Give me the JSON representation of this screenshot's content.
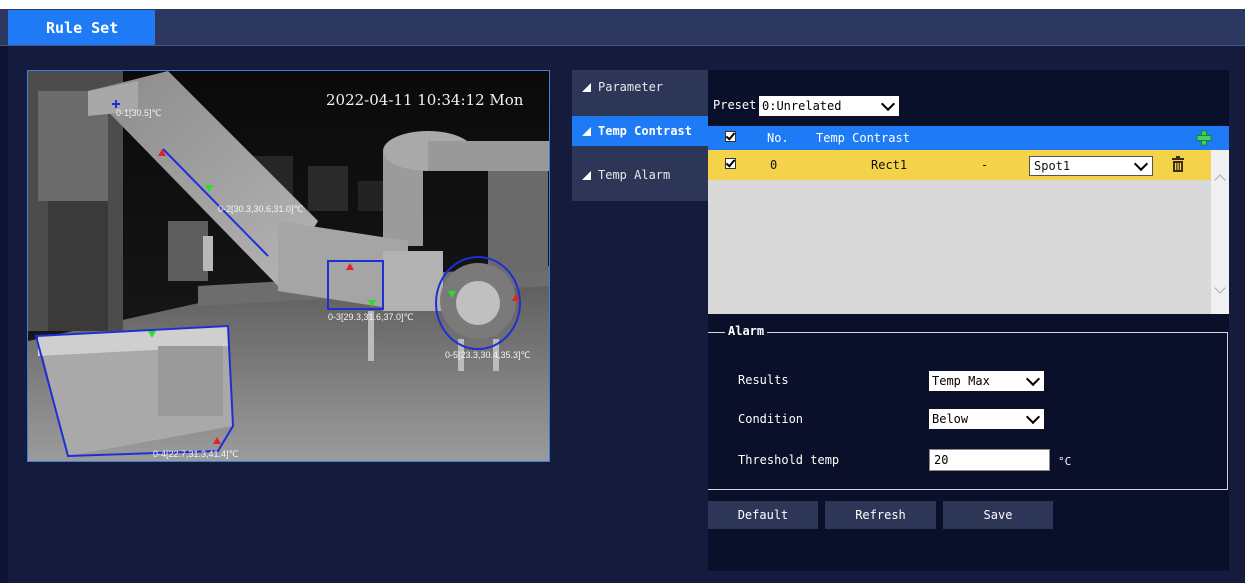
{
  "header": {
    "tab_label": "Rule Set"
  },
  "thermal": {
    "timestamp": "2022-04-11 10:34:12 Mon",
    "markers": [
      {
        "name": "marker-0-1",
        "text": "0-1[30.5]℃"
      },
      {
        "name": "marker-0-2",
        "text": "0-2[30.3,30.6,31.0]℃"
      },
      {
        "name": "marker-0-3",
        "text": "0-3[29.3,31.6,37.0]℃"
      },
      {
        "name": "marker-0-4",
        "text": "0-4[22.7,31.3,41.4]℃"
      },
      {
        "name": "marker-0-5",
        "text": "0-5[23.3,30.4,35.3]℃"
      }
    ]
  },
  "sidenav": {
    "items": [
      {
        "label": "Parameter",
        "active": false
      },
      {
        "label": "Temp Contrast",
        "active": true
      },
      {
        "label": "Temp Alarm",
        "active": false
      }
    ]
  },
  "panel": {
    "preset_label": "Preset",
    "preset_value": "0:Unrelated",
    "table": {
      "headers": {
        "no": "No.",
        "name": "Temp Contrast"
      },
      "rows": [
        {
          "checked": true,
          "no": "0",
          "rule_a": "Rect1",
          "relation": "-",
          "rule_b": "Spot1"
        }
      ]
    },
    "alarm": {
      "title": "Alarm",
      "results_label": "Results",
      "results_value": "Temp Max",
      "condition_label": "Condition",
      "condition_value": "Below",
      "threshold_label": "Threshold temp",
      "threshold_value": "20",
      "threshold_unit": "°C"
    },
    "buttons": {
      "default": "Default",
      "refresh": "Refresh",
      "save": "Save"
    }
  },
  "colors": {
    "accent": "#1e7bf5",
    "row_highlight": "#f4d34a",
    "background": "#0d1535",
    "nav_bg": "#2d3657"
  }
}
